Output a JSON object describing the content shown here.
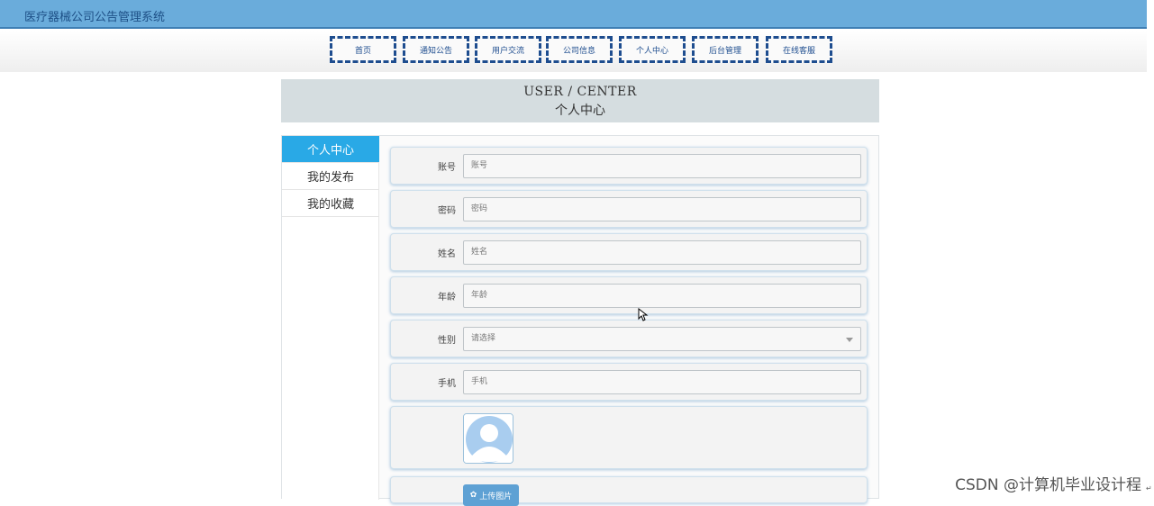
{
  "app": {
    "title": "医疗器械公司公告管理系统"
  },
  "nav": {
    "items": [
      {
        "label": "首页"
      },
      {
        "label": "通知公告"
      },
      {
        "label": "用户交流"
      },
      {
        "label": "公司信息"
      },
      {
        "label": "个人中心"
      },
      {
        "label": "后台管理"
      },
      {
        "label": "在线客服"
      }
    ]
  },
  "page_header": {
    "en_title": "USER / CENTER",
    "cn_title": "个人中心"
  },
  "sidebar": {
    "items": [
      {
        "label": "个人中心",
        "active": true
      },
      {
        "label": "我的发布",
        "active": false
      },
      {
        "label": "我的收藏",
        "active": false
      }
    ]
  },
  "form": {
    "account": {
      "label": "账号",
      "placeholder": "账号"
    },
    "password": {
      "label": "密码",
      "placeholder": "密码"
    },
    "name": {
      "label": "姓名",
      "placeholder": "姓名"
    },
    "age": {
      "label": "年龄",
      "placeholder": "年龄"
    },
    "gender": {
      "label": "性别",
      "selected": "请选择"
    },
    "phone": {
      "label": "手机",
      "placeholder": "手机"
    },
    "upload": {
      "label": "上传图片"
    }
  },
  "watermark": "CSDN @计算机毕业设计程",
  "colors": {
    "topbar": "#6aacdb",
    "nav_border": "#1e4d8f",
    "sidebar_active": "#29a9e6",
    "upload_button": "#5ea1d4"
  }
}
